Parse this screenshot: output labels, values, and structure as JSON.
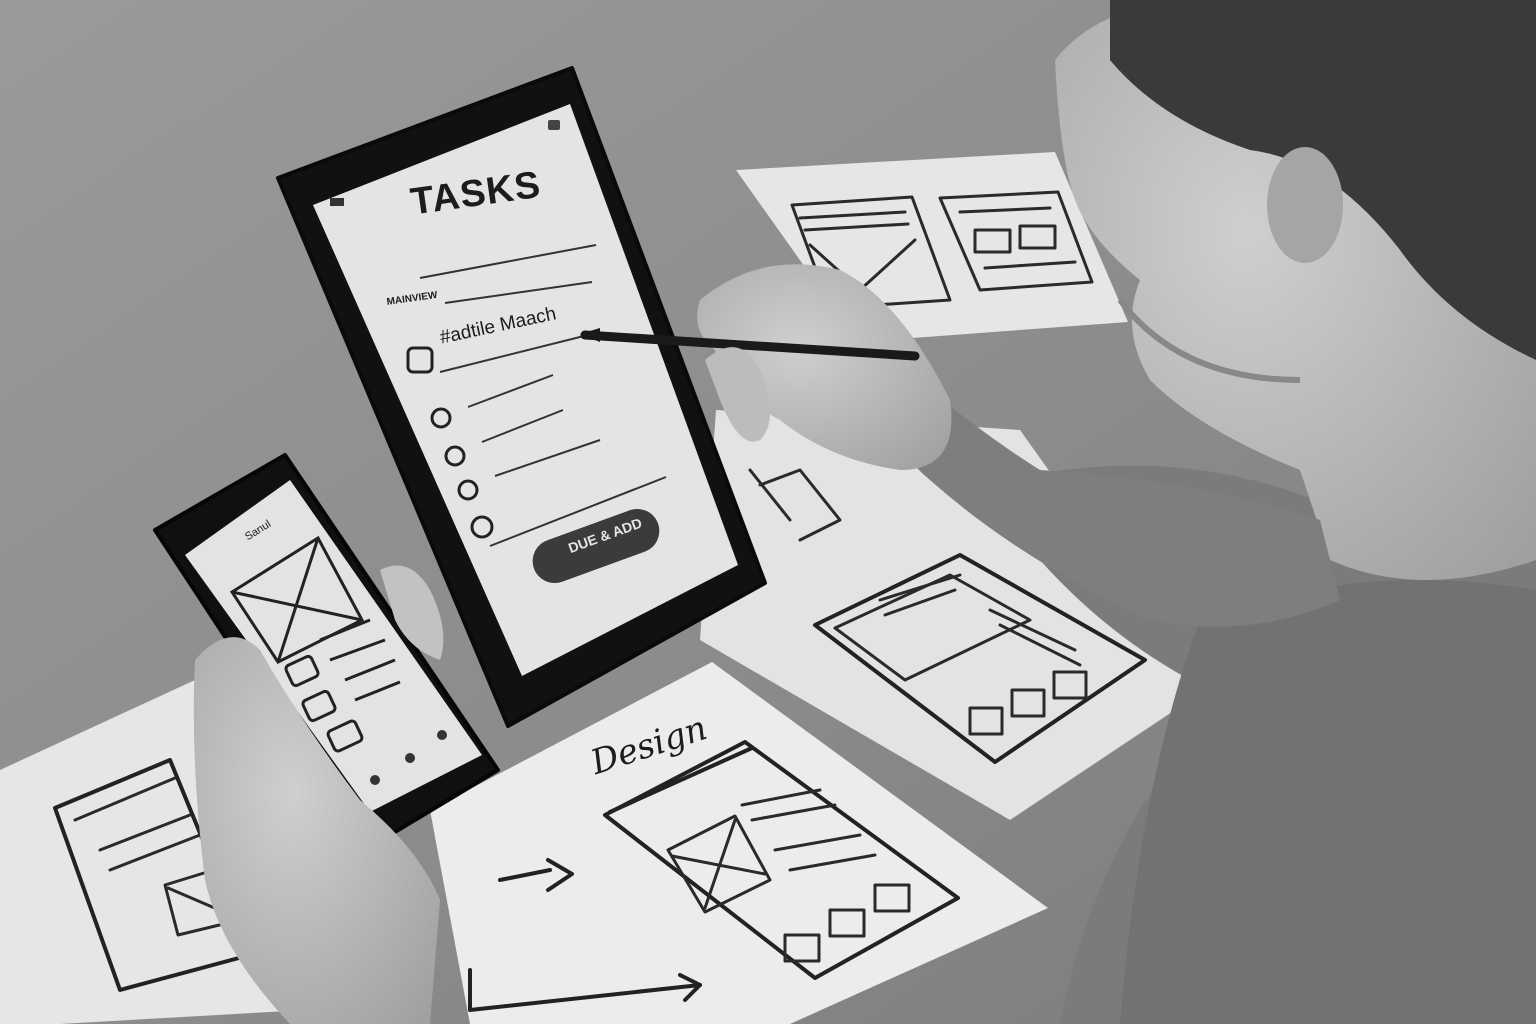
{
  "photo": {
    "tone": "black-and-white",
    "colors": {
      "desk": "#8f8f8f",
      "paper": "#e9e9e9",
      "device": "#111111",
      "screen": "#e4e4e4",
      "ink": "#222222",
      "sweater": "#7d7d7d",
      "skin": "#b9b9b9"
    }
  },
  "tablet": {
    "title": "TASKS",
    "section_label": "MAINVIEW",
    "first_task": "#adtile Maach",
    "button_label": "DUE & ADD",
    "checkbox_count": 5
  },
  "phone": {
    "header": "Sanul"
  },
  "sketch_front": {
    "heading": "Design"
  },
  "icons": [
    "stylus-pen-icon",
    "image-placeholder-icon"
  ]
}
